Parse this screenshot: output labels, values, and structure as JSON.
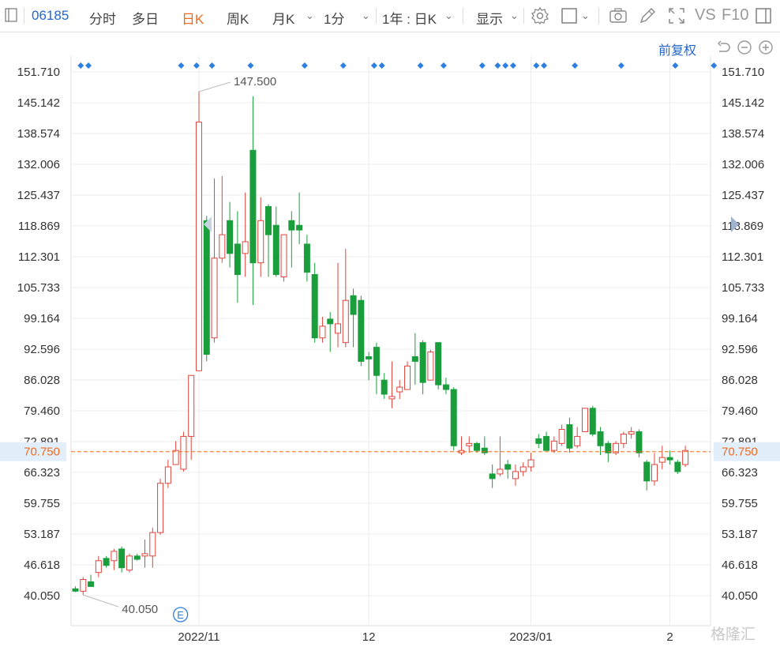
{
  "toolbar": {
    "code": "06185",
    "tabs": [
      "分时",
      "多日",
      "日K",
      "周K",
      "月K",
      "1分"
    ],
    "active_tab": "日K",
    "range": "1年 : 日K",
    "display": "显示",
    "vs": "VS",
    "f10": "F10"
  },
  "fq_label": "前复权",
  "watermark": "格隆汇",
  "colors": {
    "up": "#e0453c",
    "down": "#1a9e3c",
    "accent": "#2d7fe0",
    "current": "#f06a1e",
    "grid": "#ececec"
  },
  "chart_data": {
    "type": "candlestick",
    "y_ticks": [
      "151.710",
      "145.142",
      "138.574",
      "132.006",
      "125.437",
      "118.869",
      "112.301",
      "105.733",
      "99.164",
      "92.596",
      "86.028",
      "79.460",
      "72.891",
      "66.323",
      "59.755",
      "53.187",
      "46.618",
      "40.050"
    ],
    "ylim": [
      40.05,
      151.71
    ],
    "x_labels": [
      {
        "index": 16,
        "label": "2022/11"
      },
      {
        "index": 38,
        "label": "12"
      },
      {
        "index": 59,
        "label": "2023/01"
      },
      {
        "index": 77,
        "label": "2"
      }
    ],
    "current_price": "70.750",
    "max_label": "147.500",
    "min_label": "40.050",
    "event_marker": "E",
    "event_index": 13,
    "candles": [
      [
        41.5,
        42.0,
        40.8,
        41.0
      ],
      [
        41.0,
        44.0,
        40.2,
        43.5
      ],
      [
        43.0,
        44.5,
        42.5,
        42.0
      ],
      [
        45.0,
        48.5,
        44.0,
        47.5
      ],
      [
        48.0,
        48.5,
        46.0,
        46.5
      ],
      [
        47.5,
        50.0,
        45.5,
        49.5
      ],
      [
        50.0,
        50.5,
        45.0,
        46.0
      ],
      [
        45.5,
        49.0,
        45.0,
        48.5
      ],
      [
        48.5,
        49.0,
        47.5,
        47.8
      ],
      [
        48.5,
        52.0,
        46.0,
        49.0
      ],
      [
        48.5,
        54.5,
        46.0,
        53.5
      ],
      [
        53.5,
        65.0,
        53.0,
        64.0
      ],
      [
        64.0,
        69.0,
        63.0,
        67.5
      ],
      [
        68.0,
        73.0,
        68.0,
        71.0
      ],
      [
        67.0,
        75.0,
        66.5,
        74.0
      ],
      [
        74.0,
        87.0,
        69.0,
        87.0
      ],
      [
        88.0,
        147.5,
        88.0,
        141.0
      ],
      [
        120.0,
        121.0,
        90.0,
        91.5
      ],
      [
        95.0,
        129.0,
        94.0,
        112.0
      ],
      [
        112.0,
        129.5,
        111.0,
        117.0
      ],
      [
        120.0,
        124.0,
        110.0,
        113.0
      ],
      [
        115.0,
        122.0,
        102.5,
        108.5
      ],
      [
        113.0,
        126.0,
        108.0,
        115.5
      ],
      [
        135.0,
        146.5,
        102.0,
        111.0
      ],
      [
        111.0,
        125.0,
        108.0,
        120.0
      ],
      [
        123.0,
        123.5,
        108.0,
        117.0
      ],
      [
        119.0,
        123.0,
        108.0,
        108.5
      ],
      [
        108.0,
        117.0,
        107.0,
        117.0
      ],
      [
        120.0,
        122.0,
        110.0,
        118.0
      ],
      [
        119.0,
        126.0,
        115.0,
        118.0
      ],
      [
        115.0,
        117.0,
        107.0,
        109.0
      ],
      [
        108.5,
        111.0,
        94.0,
        95.0
      ],
      [
        95.0,
        99.5,
        94.0,
        97.5
      ],
      [
        99.0,
        100.5,
        92.0,
        98.0
      ],
      [
        96.0,
        111.0,
        93.0,
        98.0
      ],
      [
        94.0,
        114.0,
        93.0,
        103.0
      ],
      [
        104.0,
        105.5,
        93.0,
        100.0
      ],
      [
        103.0,
        104.0,
        89.0,
        90.0
      ],
      [
        91.0,
        92.0,
        86.0,
        90.5
      ],
      [
        93.0,
        94.0,
        83.0,
        87.0
      ],
      [
        86.0,
        87.5,
        82.0,
        83.0
      ],
      [
        82.0,
        90.0,
        80.0,
        82.5
      ],
      [
        83.5,
        86.0,
        82.0,
        84.5
      ],
      [
        84.0,
        90.0,
        84.0,
        89.0
      ],
      [
        91.0,
        96.0,
        85.0,
        90.0
      ],
      [
        94.0,
        94.5,
        83.0,
        85.5
      ],
      [
        86.0,
        92.5,
        86.0,
        92.0
      ],
      [
        94.0,
        94.0,
        84.0,
        85.0
      ],
      [
        85.0,
        86.5,
        83.0,
        84.0
      ],
      [
        84.0,
        84.5,
        71.0,
        72.0
      ],
      [
        70.5,
        74.0,
        70.0,
        71.0
      ],
      [
        72.0,
        74.0,
        70.5,
        72.5
      ],
      [
        72.5,
        72.8,
        70.5,
        71.0
      ],
      [
        71.5,
        74.0,
        70.0,
        70.5
      ],
      [
        66.0,
        68.0,
        63.0,
        65.0
      ],
      [
        66.0,
        74.0,
        65.5,
        67.0
      ],
      [
        68.0,
        69.0,
        65.0,
        67.0
      ],
      [
        65.0,
        68.0,
        63.5,
        66.5
      ],
      [
        66.5,
        68.5,
        65.5,
        67.5
      ],
      [
        67.5,
        70.5,
        66.5,
        69.0
      ],
      [
        73.5,
        74.5,
        71.5,
        72.5
      ],
      [
        74.0,
        75.0,
        71.0,
        71.0
      ],
      [
        71.0,
        74.0,
        70.5,
        73.0
      ],
      [
        72.5,
        76.5,
        72.0,
        75.5
      ],
      [
        76.5,
        78.0,
        70.5,
        71.5
      ],
      [
        72.0,
        76.0,
        71.5,
        74.0
      ],
      [
        75.0,
        80.0,
        75.0,
        80.0
      ],
      [
        80.0,
        80.5,
        74.0,
        74.5
      ],
      [
        75.0,
        76.0,
        70.0,
        72.0
      ],
      [
        72.5,
        73.0,
        68.5,
        70.5
      ],
      [
        70.5,
        73.0,
        70.0,
        72.5
      ],
      [
        72.5,
        75.0,
        71.5,
        74.5
      ],
      [
        74.5,
        76.0,
        73.5,
        75.0
      ],
      [
        75.0,
        75.5,
        69.5,
        70.5
      ],
      [
        68.5,
        69.0,
        62.5,
        64.5
      ],
      [
        64.5,
        70.5,
        63.5,
        68.0
      ],
      [
        68.5,
        72.0,
        67.0,
        69.5
      ],
      [
        69.5,
        71.0,
        68.0,
        69.0
      ],
      [
        68.5,
        69.0,
        66.0,
        66.5
      ],
      [
        68.0,
        72.0,
        67.5,
        71.0
      ]
    ],
    "blue_markers": [
      1,
      2,
      14,
      16,
      18,
      23,
      30,
      35,
      39,
      40,
      45,
      48,
      53,
      55,
      56,
      57,
      60,
      61,
      65,
      71,
      78,
      83
    ]
  }
}
